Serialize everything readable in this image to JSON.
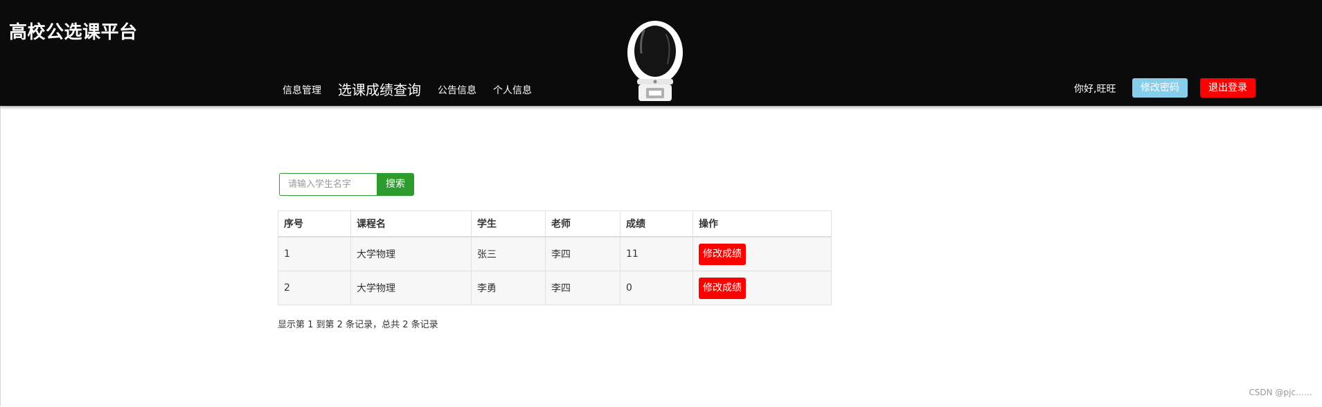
{
  "brand": {
    "title": "高校公选课平台"
  },
  "nav": {
    "items": [
      {
        "label": "信息管理"
      },
      {
        "label": "选课成绩查询"
      },
      {
        "label": "公告信息"
      },
      {
        "label": "个人信息"
      }
    ]
  },
  "user": {
    "greeting": "你好,旺旺",
    "change_password_label": "修改密码",
    "logout_label": "退出登录"
  },
  "colors": {
    "header_bg": "#0b0b0b",
    "search_accent": "#2e9b2e",
    "change_password_bg": "#87ceeb",
    "danger": "#ff0000"
  },
  "search": {
    "placeholder": "请输入学生名字",
    "button_label": "搜索"
  },
  "table": {
    "headers": [
      "序号",
      "课程名",
      "学生",
      "老师",
      "成绩",
      "操作"
    ],
    "rows": [
      {
        "index": "1",
        "course": "大学物理",
        "student": "张三",
        "teacher": "李四",
        "score": "11",
        "action_label": "修改成绩"
      },
      {
        "index": "2",
        "course": "大学物理",
        "student": "李勇",
        "teacher": "李四",
        "score": "0",
        "action_label": "修改成绩"
      }
    ]
  },
  "pagination": {
    "info": "显示第 1 到第 2 条记录，总共 2 条记录"
  },
  "watermark": {
    "text": "CSDN @pjc……"
  },
  "icons": {
    "mascot": "astronaut-icon"
  }
}
